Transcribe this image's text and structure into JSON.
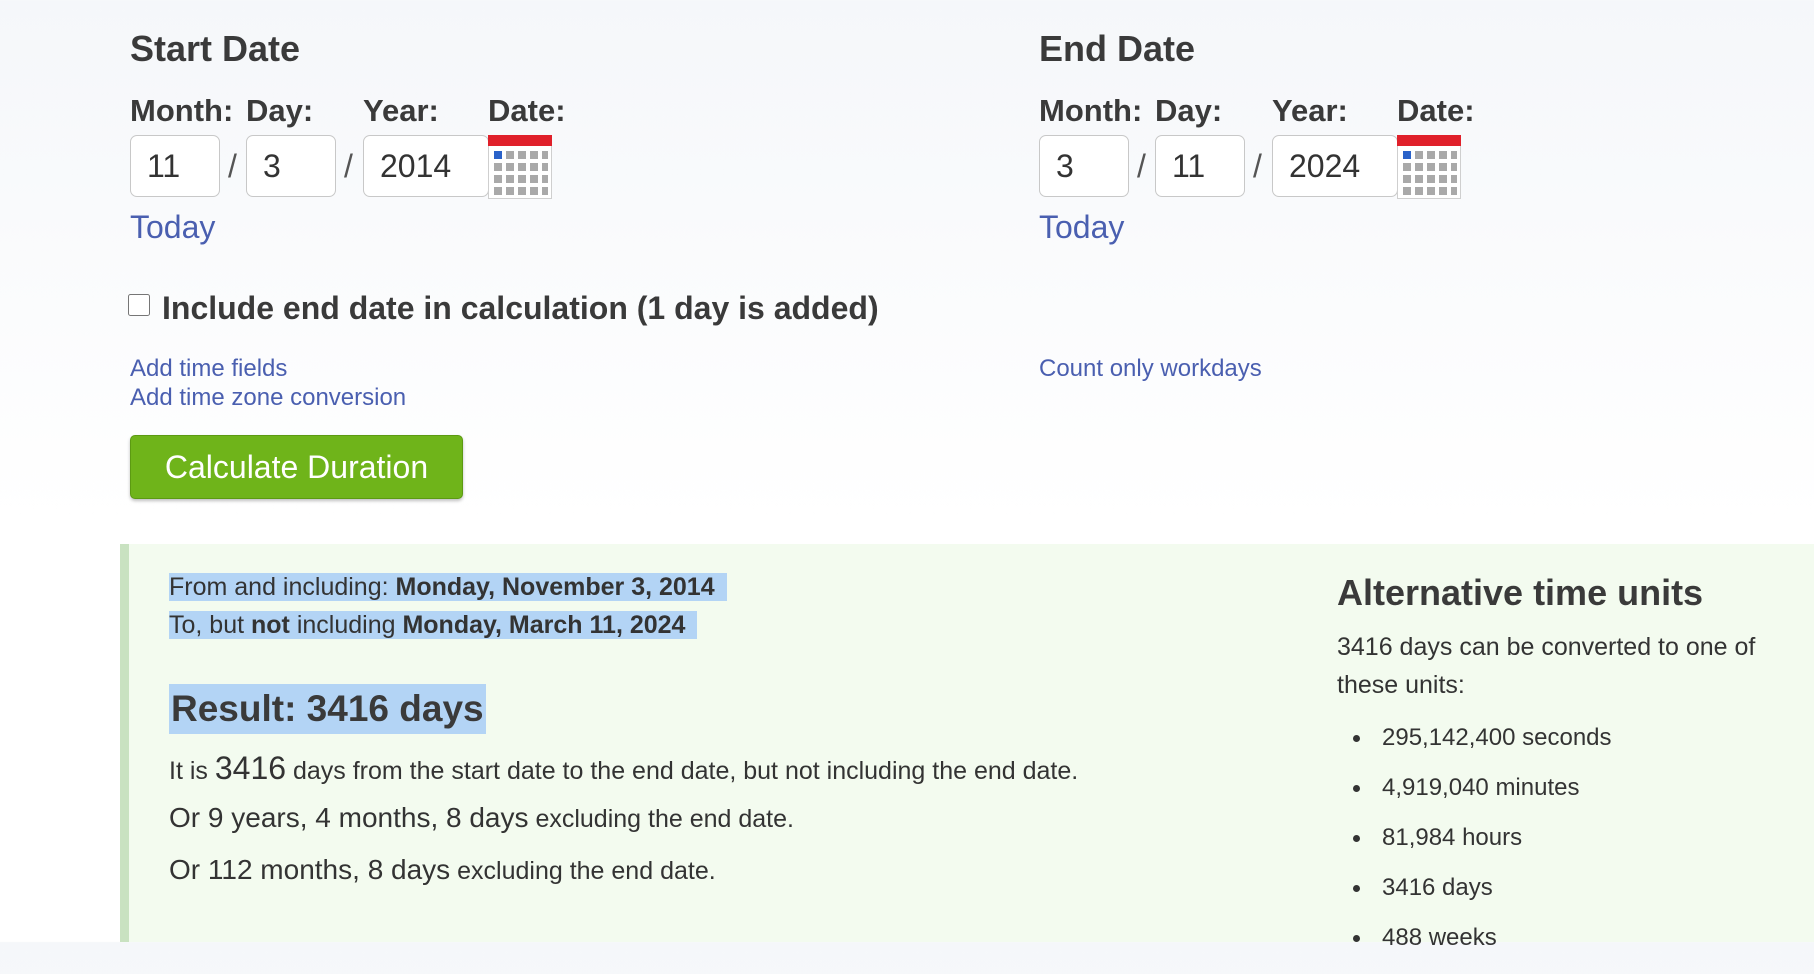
{
  "start": {
    "heading": "Start Date",
    "month_label": "Month:",
    "day_label": "Day:",
    "year_label": "Year:",
    "date_label": "Date:",
    "month": "11",
    "day": "3",
    "year": "2014",
    "separator": "/",
    "today_link": "Today"
  },
  "end": {
    "heading": "End Date",
    "month_label": "Month:",
    "day_label": "Day:",
    "year_label": "Year:",
    "date_label": "Date:",
    "month": "3",
    "day": "11",
    "year": "2024",
    "separator": "/",
    "today_link": "Today"
  },
  "options": {
    "include_end_label": "Include end date in calculation (1 day is added)",
    "include_end_checked": false,
    "add_time_fields": "Add time fields",
    "add_time_zone": "Add time zone conversion",
    "count_workdays": "Count only workdays"
  },
  "calculate_button": "Calculate Duration",
  "result": {
    "from_prefix": "From and including: ",
    "from_date": "Monday, November 3, 2014",
    "to_prefix": "To, but ",
    "to_not": "not",
    "to_mid": " including ",
    "to_date": "Monday, March 11, 2024",
    "heading": "Result: 3416 days",
    "line1_prefix": "It is ",
    "line1_value": "3416",
    "line1_suffix": " days from the start date to the end date, but not including the end date.",
    "line2_prefix": "Or ",
    "line2_value": "9 years, 4 months, 8 days",
    "line2_suffix": " excluding the end date.",
    "line3_prefix": "Or ",
    "line3_value": "112 months, 8 days",
    "line3_suffix": " excluding the end date."
  },
  "alternative": {
    "heading": "Alternative time units",
    "intro": "3416 days can be converted to one of these units:",
    "units": [
      "295,142,400 seconds",
      "4,919,040 minutes",
      "81,984 hours",
      "3416 days",
      "488 weeks"
    ]
  },
  "colors": {
    "link": "#4a5fb0",
    "button": "#6fb41a",
    "result_bg": "#f3fbef",
    "highlight": "#b3d4f5",
    "calendar_red": "#e0202a"
  }
}
